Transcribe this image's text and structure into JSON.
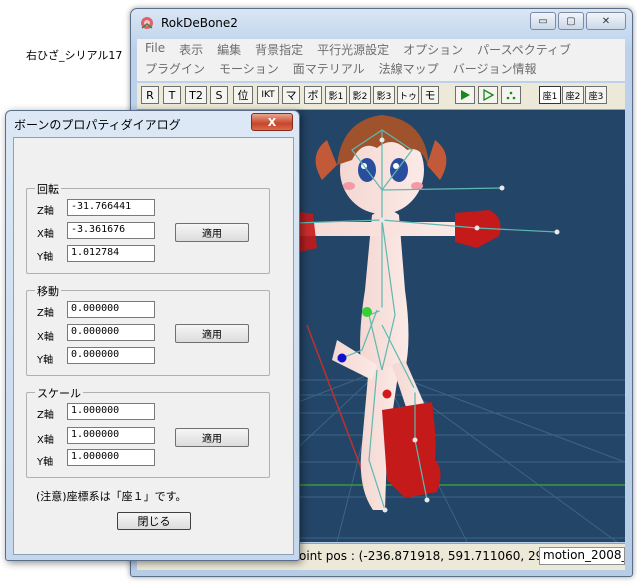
{
  "main_window": {
    "title": "RokDeBone2",
    "controls": {
      "minimize": "▭",
      "maximize": "▢",
      "close": "✕"
    },
    "menu_row1": [
      "File",
      "表示",
      "編集",
      "背景指定",
      "平行光源設定",
      "オプション",
      "パースペクティブ"
    ],
    "menu_row2": [
      "プラグイン",
      "モーション",
      "面マテリアル",
      "法線マップ",
      "バージョン情報"
    ],
    "toolbar": {
      "buttons": [
        "R",
        "T",
        "T2",
        "S",
        "位",
        "IKT",
        "マ",
        "ボ",
        "影1",
        "影2",
        "影3",
        "トゥ",
        "モ"
      ],
      "play_icons": [
        "play-filled-icon",
        "play-outline-icon",
        "dots-icon"
      ],
      "coord_buttons": [
        "座1",
        "座2",
        "座3"
      ]
    },
    "status": {
      "point_pos": "oint pos : (-236.871918, 591.711060, 29.",
      "motion_file": "motion_2008_"
    }
  },
  "dialog": {
    "title": "ボーンのプロパティダイアログ",
    "close_glyph": "X",
    "bone_name": "右ひざ_シリアル17",
    "rotation": {
      "legend": "回転",
      "rows": [
        {
          "label": "Z軸",
          "value": "-31.766441"
        },
        {
          "label": "X軸",
          "value": "-3.361676"
        },
        {
          "label": "Y軸",
          "value": "1.012784"
        }
      ],
      "apply": "適用"
    },
    "translation": {
      "legend": "移動",
      "rows": [
        {
          "label": "Z軸",
          "value": "0.000000"
        },
        {
          "label": "X軸",
          "value": "0.000000"
        },
        {
          "label": "Y軸",
          "value": "0.000000"
        }
      ],
      "apply": "適用"
    },
    "scale": {
      "legend": "スケール",
      "rows": [
        {
          "label": "Z軸",
          "value": "1.000000"
        },
        {
          "label": "X軸",
          "value": "1.000000"
        },
        {
          "label": "Y軸",
          "value": "1.000000"
        }
      ],
      "apply": "適用"
    },
    "note": "(注意)座標系は「座１」です。",
    "close_label": "閉じる"
  },
  "colors": {
    "viewport_bg": "#234567",
    "glove_red": "#c41a1a",
    "bone_teal": "#5fb8b0",
    "hair_brown": "#a0522d"
  }
}
